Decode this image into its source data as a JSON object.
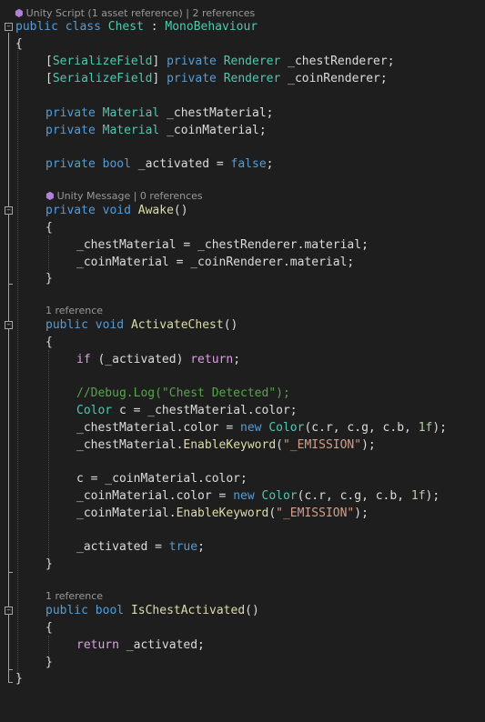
{
  "codelens": {
    "class": {
      "icon": "unity-cube-icon",
      "text": "Unity Script (1 asset reference) | 2 references"
    },
    "awake": {
      "icon": "unity-cube-icon",
      "text": "Unity Message | 0 references"
    },
    "activate_chest": {
      "text": "1 reference"
    },
    "is_chest_activated": {
      "text": "1 reference"
    }
  },
  "code": {
    "class_decl": {
      "kw_public": "public",
      "kw_class": "class",
      "name": "Chest",
      "colon": " : ",
      "base": "MonoBehaviour"
    },
    "open_brace": "{",
    "close_brace": "}",
    "field1": {
      "lb": "[",
      "attr": "SerializeField",
      "rb": "]",
      "kw": "private",
      "type": "Renderer",
      "name": "_chestRenderer;"
    },
    "field2": {
      "lb": "[",
      "attr": "SerializeField",
      "rb": "]",
      "kw": "private",
      "type": "Renderer",
      "name": "_coinRenderer;"
    },
    "field3": {
      "kw": "private",
      "type": "Material",
      "name": "_chestMaterial;"
    },
    "field4": {
      "kw": "private",
      "type": "Material",
      "name": "_coinMaterial;"
    },
    "field5": {
      "kw": "private",
      "type": "bool",
      "name": "_activated",
      "eq": " = ",
      "value": "false",
      "semi": ";"
    },
    "awake": {
      "kw_private": "private",
      "kw_void": "void",
      "name": "Awake",
      "paren": "()",
      "open": "{",
      "line1": "_chestMaterial = _chestRenderer.material;",
      "line2": "_coinMaterial = _coinRenderer.material;",
      "close": "}"
    },
    "activate": {
      "kw_public": "public",
      "kw_void": "void",
      "name": "ActivateChest",
      "paren": "()",
      "open": "{",
      "if_kw": "if",
      "if_cond": " (_activated) ",
      "return_kw": "return",
      "if_semi": ";",
      "comment": "//Debug.Log(\"Chest Detected\");",
      "color_type": "Color",
      "color_decl": " c = _chestMaterial.color;",
      "chest_color_prefix": "_chestMaterial.color = ",
      "new_kw": "new",
      "color_ctor": "Color",
      "ctor_args_pre": "(c.r, c.g, c.b, ",
      "one_f": "1f",
      "ctor_args_post": ");",
      "chest_emission_obj": "_chestMaterial.",
      "enable_keyword": "EnableKeyword",
      "emission_str": "\"_EMISSION\"",
      "emission_open": "(",
      "emission_close": ");",
      "c_assign": "c = _coinMaterial.color;",
      "coin_color_prefix": "_coinMaterial.color = ",
      "coin_emission_obj": "_coinMaterial.",
      "activated_prefix": "_activated = ",
      "true_kw": "true",
      "activated_semi": ";",
      "close": "}"
    },
    "is_activated": {
      "kw_public": "public",
      "kw_bool": "bool",
      "name": "IsChestActivated",
      "paren": "()",
      "open": "{",
      "return_kw": "return",
      "return_val": " _activated;",
      "close": "}"
    }
  },
  "colors": {
    "background": "#1e1e1e",
    "keyword": "#569cd6",
    "control": "#d8a0df",
    "type": "#4ec9b0",
    "method": "#dcdcaa",
    "string": "#d69d85",
    "comment": "#57a64a",
    "number": "#b5cea8"
  }
}
